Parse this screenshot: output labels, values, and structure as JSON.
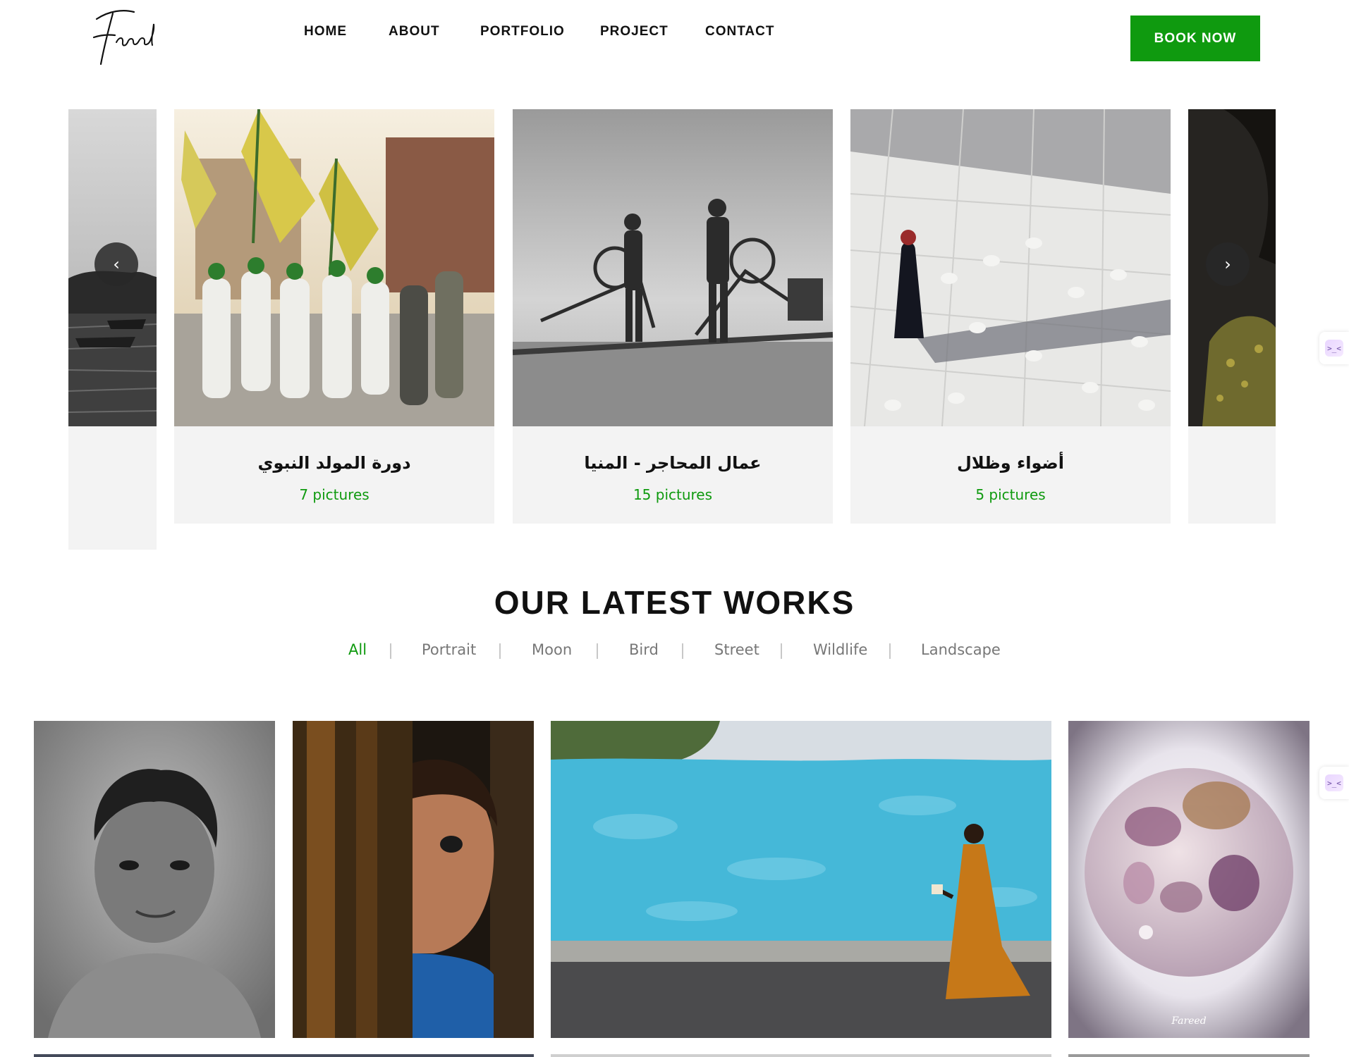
{
  "header": {
    "logo_text": "Fareed",
    "nav": [
      "HOME",
      "ABOUT",
      "PORTFOLIO",
      "PROJECT",
      "CONTACT"
    ],
    "cta": "BOOK NOW"
  },
  "carousel": {
    "cards": [
      {
        "title": "دورة المولد النبوي",
        "count": "7 pictures"
      },
      {
        "title": "عمال المحاجر - المنيا",
        "count": "15 pictures"
      },
      {
        "title": "أضواء وظلال",
        "count": "5 pictures"
      }
    ],
    "prev_icon": "chevron-left-icon",
    "next_icon": "chevron-right-icon"
  },
  "latest": {
    "title": "OUR LATEST WORKS",
    "filters": [
      "All",
      "Portrait",
      "Moon",
      "Bird",
      "Street",
      "Wildlife",
      "Landscape"
    ],
    "active_filter": "All",
    "watermark": "Fareed"
  },
  "widget": {
    "glyph": ">_<"
  },
  "colors": {
    "accent": "#0f9a0f",
    "card_bg": "#f3f3f3",
    "text": "#111111",
    "muted": "#777777"
  }
}
